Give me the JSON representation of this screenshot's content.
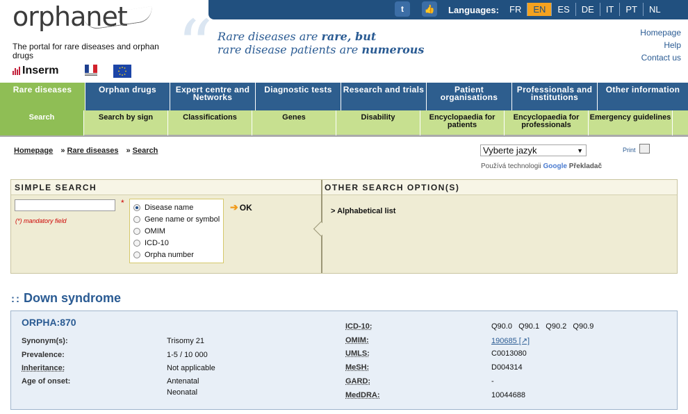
{
  "header": {
    "logo": "orphanet",
    "tagline": "The portal for rare diseases and orphan drugs",
    "inserm": "Inserm",
    "languages_label": "Languages:",
    "languages": [
      "FR",
      "EN",
      "ES",
      "DE",
      "IT",
      "PT",
      "NL"
    ],
    "active_language": "EN",
    "slogan_line1_pre": "Rare diseases are ",
    "slogan_line1_bold": "rare, but",
    "slogan_line2_pre": "rare disease patients are ",
    "slogan_line2_bold": "numerous",
    "links": [
      "Homepage",
      "Help",
      "Contact us"
    ]
  },
  "main_nav": [
    {
      "label": "Rare diseases",
      "active": true
    },
    {
      "label": "Orphan drugs",
      "active": false
    },
    {
      "label": "Expert centre and Networks",
      "active": false
    },
    {
      "label": "Diagnostic tests",
      "active": false
    },
    {
      "label": "Research and trials",
      "active": false
    },
    {
      "label": "Patient organisations",
      "active": false
    },
    {
      "label": "Professionals and institutions",
      "active": false
    },
    {
      "label": "Other information",
      "active": false
    }
  ],
  "sub_nav": [
    {
      "label": "Search",
      "active": true
    },
    {
      "label": "Search by sign",
      "active": false
    },
    {
      "label": "Classifications",
      "active": false
    },
    {
      "label": "Genes",
      "active": false
    },
    {
      "label": "Disability",
      "active": false
    },
    {
      "label": "Encyclopaedia for patients",
      "active": false
    },
    {
      "label": "Encyclopaedia for professionals",
      "active": false
    },
    {
      "label": "Emergency guidelines",
      "active": false
    }
  ],
  "breadcrumb": [
    "Homepage",
    "Rare diseases",
    "Search"
  ],
  "translate": {
    "select_value": "Vyberte jazyk",
    "powered_by": "Používá technologii",
    "google": "Google",
    "translator": "Překladač"
  },
  "print_label": "Print",
  "search": {
    "simple_title": "SIMPLE SEARCH",
    "other_title": "OTHER SEARCH OPTION(S)",
    "required_mark": "*",
    "mandatory_note": "(*) mandatory field",
    "options": [
      "Disease name",
      "Gene name or symbol",
      "OMIM",
      "ICD-10",
      "Orpha number"
    ],
    "selected_option": "Disease name",
    "ok_label": "OK",
    "alphabetical": "> Alphabetical list"
  },
  "disease": {
    "title": "Down syndrome",
    "orpha": "ORPHA:870",
    "left_fields": [
      {
        "label": "Synonym(s):",
        "values": [
          "Trisomy 21"
        ],
        "abbr": false
      },
      {
        "label": "Prevalence:",
        "values": [
          "1-5 / 10 000"
        ],
        "abbr": false
      },
      {
        "label": "Inheritance:",
        "values": [
          "Not applicable"
        ],
        "abbr": true
      },
      {
        "label": "Age of onset:",
        "values": [
          "Antenatal",
          "Neonatal"
        ],
        "abbr": false
      }
    ],
    "right_fields": [
      {
        "label": "ICD-10:",
        "value": "Q90.0   Q90.1   Q90.2   Q90.9",
        "link": false
      },
      {
        "label": "OMIM:",
        "value": "190685 [↗]",
        "link": true
      },
      {
        "label": "UMLS:",
        "value": "C0013080",
        "link": false
      },
      {
        "label": "MeSH:",
        "value": "D004314",
        "link": false
      },
      {
        "label": "GARD:",
        "value": "-",
        "link": false
      },
      {
        "label": "MedDRA:",
        "value": "10044688",
        "link": false
      }
    ]
  }
}
